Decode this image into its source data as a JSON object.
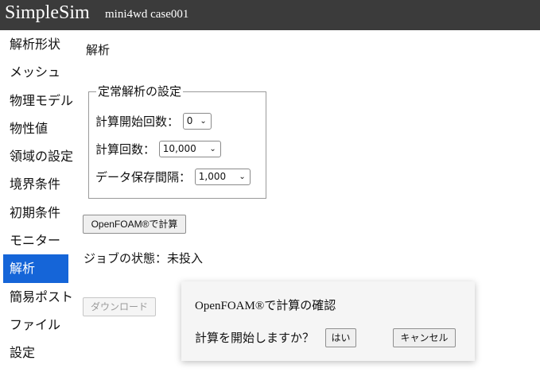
{
  "header": {
    "brand": "SimpleSim",
    "case": "mini4wd case001"
  },
  "sidebar": {
    "items": [
      {
        "label": "解析形状"
      },
      {
        "label": "メッシュ"
      },
      {
        "label": "物理モデル"
      },
      {
        "label": "物性値"
      },
      {
        "label": "領域の設定"
      },
      {
        "label": "境界条件"
      },
      {
        "label": "初期条件"
      },
      {
        "label": "モニター"
      },
      {
        "label": "解析",
        "active": true
      },
      {
        "label": "簡易ポスト"
      },
      {
        "label": "ファイル"
      },
      {
        "label": "設定"
      }
    ]
  },
  "main": {
    "title": "解析",
    "steady": {
      "legend": "定常解析の設定",
      "start_label": "計算開始回数：",
      "start_value": "0",
      "iter_label": "計算回数：",
      "iter_value": "10,000",
      "save_label": "データ保存間隔：",
      "save_value": "1,000"
    },
    "run_label": "OpenFOAM®で計算",
    "job_status": "ジョブの状態：未投入",
    "download_label": "ダウンロード"
  },
  "dialog": {
    "title": "OpenFOAM®で計算の確認",
    "message": "計算を開始しますか？",
    "yes_label": "はい",
    "cancel_label": "キャンセル"
  },
  "icons": {
    "select_arrow": "chevron-down-icon"
  }
}
